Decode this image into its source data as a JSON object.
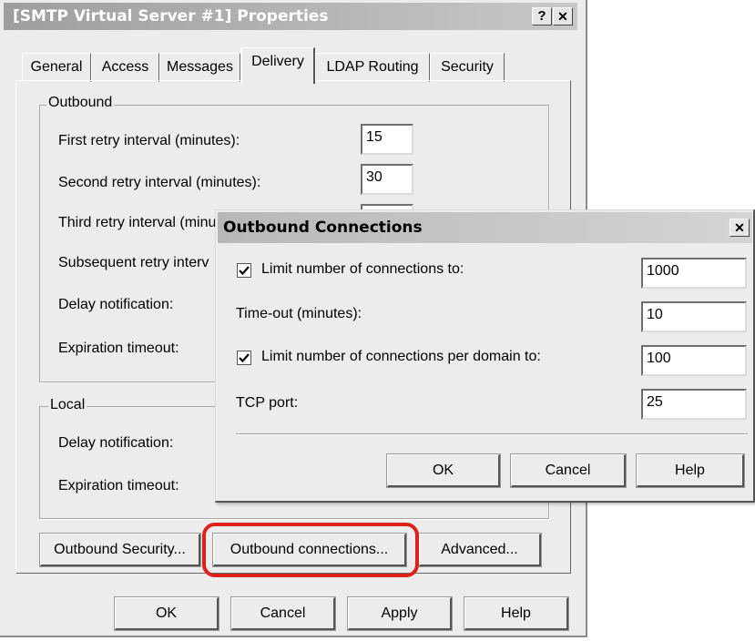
{
  "main_window": {
    "title": "[SMTP Virtual Server #1] Properties",
    "help_glyph": "?",
    "close_glyph": "✕",
    "tabs": [
      "General",
      "Access",
      "Messages",
      "Delivery",
      "LDAP Routing",
      "Security"
    ],
    "active_tab": "Delivery",
    "outbound": {
      "title": "Outbound",
      "first_retry_label": "First retry interval (minutes):",
      "first_retry_value": "15",
      "second_retry_label": "Second retry interval (minutes):",
      "second_retry_value": "30",
      "third_retry_label": "Third retry interval (minu",
      "subsequent_retry_label": "Subsequent retry interv",
      "delay_notification_label": "Delay notification:",
      "expiration_timeout_label": "Expiration timeout:"
    },
    "local": {
      "title": "Local",
      "delay_notification_label": "Delay notification:",
      "expiration_timeout_label": "Expiration timeout:"
    },
    "outbound_security_button": "Outbound Security...",
    "outbound_connections_button": "Outbound connections...",
    "advanced_button": "Advanced...",
    "ok_button": "OK",
    "cancel_button": "Cancel",
    "apply_button": "Apply",
    "help_button": "Help"
  },
  "popup": {
    "title": "Outbound Connections",
    "close_glyph": "✕",
    "limit_connections_label": "Limit number of connections to:",
    "limit_connections_checked": true,
    "limit_connections_value": "1000",
    "timeout_label": "Time-out (minutes):",
    "timeout_value": "10",
    "limit_per_domain_label": "Limit number of connections per domain to:",
    "limit_per_domain_checked": true,
    "limit_per_domain_value": "100",
    "tcp_port_label": "TCP port:",
    "tcp_port_value": "25",
    "ok_button": "OK",
    "cancel_button": "Cancel",
    "help_button": "Help"
  },
  "colors": {
    "dialog_bg": "#ececec",
    "highlight": "#e0201a"
  },
  "icons": [
    "help-icon",
    "close-icon",
    "checkmark-icon"
  ]
}
